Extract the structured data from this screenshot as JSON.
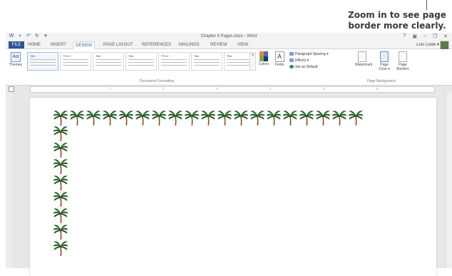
{
  "callout": {
    "line1": "Zoom in to see page",
    "line2": "border more clearly."
  },
  "window": {
    "doc_title": "Chapter 6 Pages.docx - Word",
    "controls": [
      "?",
      "▣",
      "–",
      "❐",
      "✕"
    ],
    "user_name": "Lois Lowe ▾"
  },
  "quick_access": [
    "W",
    "▪",
    "↶",
    "↻",
    "▾"
  ],
  "tabs": [
    {
      "label": "FILE"
    },
    {
      "label": "HOME"
    },
    {
      "label": "INSERT"
    },
    {
      "label": "DESIGN"
    },
    {
      "label": "PAGE LAYOUT"
    },
    {
      "label": "REFERENCES"
    },
    {
      "label": "MAILINGS"
    },
    {
      "label": "REVIEW"
    },
    {
      "label": "VIEW"
    }
  ],
  "active_tab": "DESIGN",
  "ribbon": {
    "themes_label": "Themes",
    "style_thumbs": [
      "Title",
      "TITLE",
      "Title",
      "Title",
      "TITLE",
      "Title",
      "Title"
    ],
    "document_formatting_label": "Document Formatting",
    "colors_label": "Colors",
    "fonts_label": "Fonts",
    "paragraph_spacing": "Paragraph Spacing ▾",
    "effects": "Effects ▾",
    "set_as_default": "Set as Default",
    "watermark": "Watermark",
    "page_color": "Page Color ▾",
    "page_borders": "Page Borders",
    "page_background_label": "Page Background"
  },
  "ruler": {
    "numbers": [
      "1",
      "2",
      "3",
      "4",
      "5",
      "6"
    ]
  },
  "page_border": {
    "motif": "palm-tree",
    "top_count": 19,
    "left_count": 8,
    "trunk_color": "#8b4513",
    "leaf_color": "#1f5f1f"
  }
}
